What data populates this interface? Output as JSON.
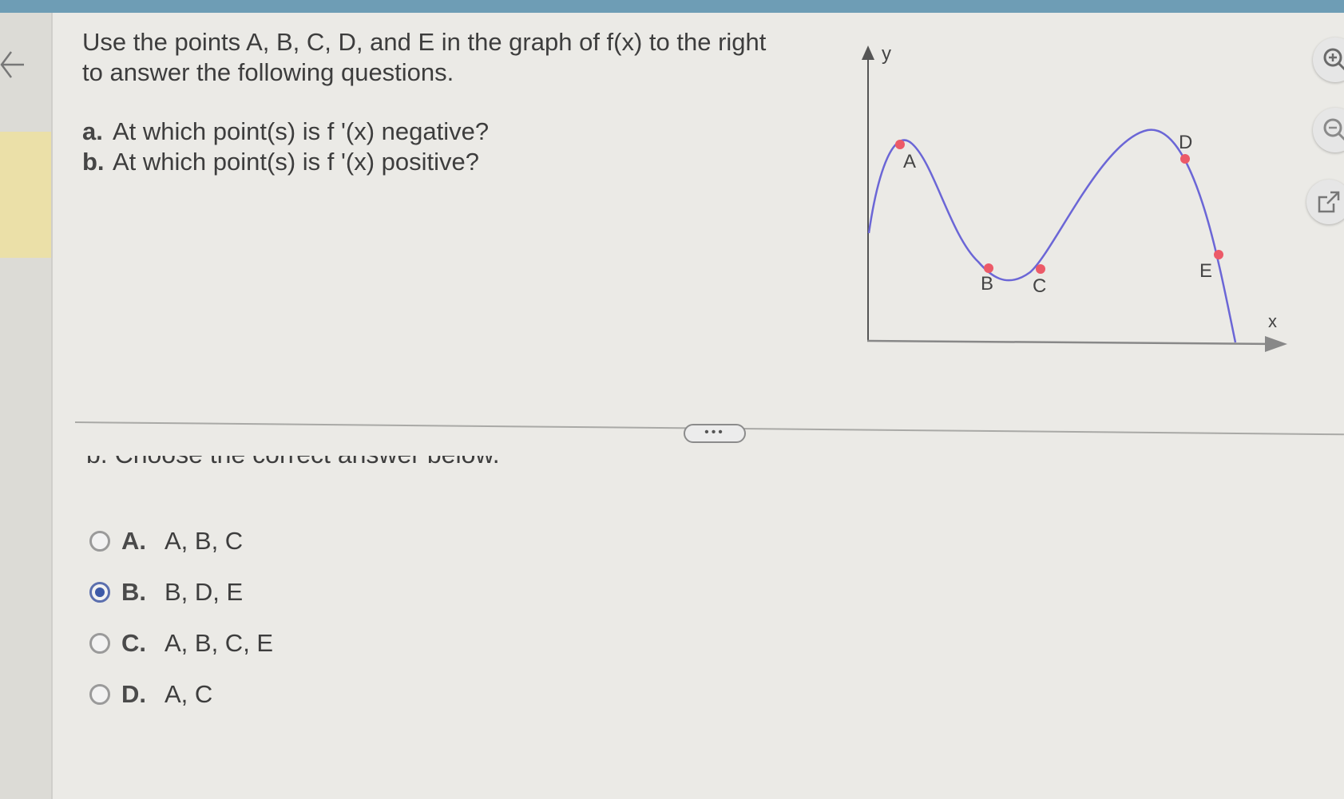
{
  "question": {
    "intro_line1": "Use the points A, B, C,  D, and E in the graph of f(x) to the right",
    "intro_line2": "to answer the following questions.",
    "parts": [
      {
        "letter": "a.",
        "text": "At which point(s) is f '(x) negative?"
      },
      {
        "letter": "b.",
        "text": "At which point(s) is f '(x) positive?"
      }
    ]
  },
  "graph": {
    "y_axis_label": "y",
    "x_axis_label": "x",
    "points": [
      "A",
      "B",
      "C",
      "D",
      "E"
    ],
    "curve_color": "#6b66d6",
    "point_color": "#ec5a68"
  },
  "toolbar": {
    "zoom_in_icon": "zoom-in-icon",
    "zoom_out_icon": "zoom-out-icon",
    "popout_icon": "external-link-icon"
  },
  "divider": {
    "more_label": "•••"
  },
  "answer": {
    "prompt": "b. Choose the correct answer below.",
    "options": [
      {
        "letter": "A.",
        "text": "A, B, C",
        "selected": false
      },
      {
        "letter": "B.",
        "text": "B, D, E",
        "selected": true
      },
      {
        "letter": "C.",
        "text": "A, B, C, E",
        "selected": false
      },
      {
        "letter": "D.",
        "text": "A, C",
        "selected": false
      }
    ]
  }
}
